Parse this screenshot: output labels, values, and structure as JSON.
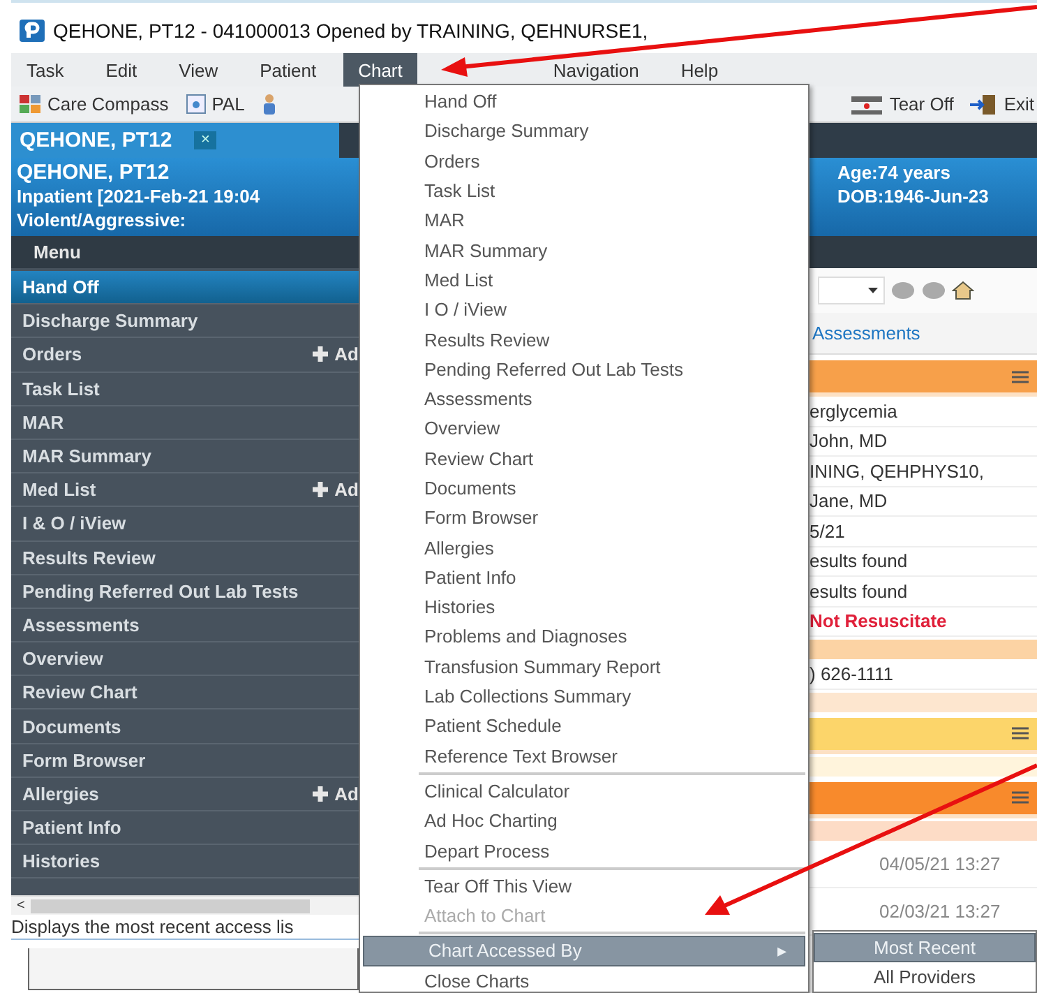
{
  "window": {
    "title": "QEHONE, PT12 - 041000013 Opened by TRAINING, QEHNURSE1,"
  },
  "menu_bar": [
    {
      "label": "Task",
      "selected": false
    },
    {
      "label": "Edit",
      "selected": false
    },
    {
      "label": "View",
      "selected": false
    },
    {
      "label": "Patient",
      "selected": false
    },
    {
      "label": "Chart",
      "selected": true
    },
    {
      "label": "Navigation",
      "selected": false
    },
    {
      "label": "Help",
      "selected": false
    }
  ],
  "toolbar": {
    "left": [
      {
        "kind": "compass",
        "label": "Care Compass"
      },
      {
        "kind": "pal",
        "label": "PAL"
      },
      {
        "kind": "person"
      }
    ],
    "right": [
      {
        "kind": "tearoff",
        "label": "Tear Off"
      },
      {
        "kind": "exit",
        "label": "Exit"
      }
    ]
  },
  "patient_tab": {
    "label": "QEHONE, PT12",
    "close": "×"
  },
  "banner": {
    "name": "QEHONE, PT12",
    "encounter": "Inpatient [2021-Feb-21 19:04",
    "alert": "Violent/Aggressive:",
    "age": "Age:74 years",
    "dob": "DOB:1946-Jun-23"
  },
  "sidebar": {
    "header": "Menu",
    "items": [
      {
        "label": "Hand Off",
        "selected": true
      },
      {
        "label": "Discharge Summary",
        "selected": false
      },
      {
        "label": "Orders",
        "selected": false,
        "action": "Ad"
      },
      {
        "label": "Task List",
        "selected": false
      },
      {
        "label": "MAR",
        "selected": false
      },
      {
        "label": "MAR Summary",
        "selected": false
      },
      {
        "label": "Med List",
        "selected": false,
        "action": "Ad"
      },
      {
        "label": "I & O / iView",
        "selected": false
      },
      {
        "label": "Results Review",
        "selected": false
      },
      {
        "label": "Pending Referred Out Lab Tests",
        "selected": false
      },
      {
        "label": "Assessments",
        "selected": false
      },
      {
        "label": "Overview",
        "selected": false
      },
      {
        "label": "Review Chart",
        "selected": false
      },
      {
        "label": "Documents",
        "selected": false
      },
      {
        "label": "Form Browser",
        "selected": false
      },
      {
        "label": "Allergies",
        "selected": false,
        "action": "Ad"
      },
      {
        "label": "Patient Info",
        "selected": false
      },
      {
        "label": "Histories",
        "selected": false
      }
    ]
  },
  "scroll_arrow": "<",
  "status_bar": "Displays the most recent access lis",
  "chart_menu": [
    {
      "kind": "item",
      "label": "Hand Off",
      "disabled": false,
      "selected": false
    },
    {
      "kind": "item",
      "label": "Discharge Summary",
      "disabled": false,
      "selected": false
    },
    {
      "kind": "item",
      "label": "Orders",
      "disabled": false,
      "selected": false
    },
    {
      "kind": "item",
      "label": "Task List",
      "disabled": false,
      "selected": false
    },
    {
      "kind": "item",
      "label": "MAR",
      "disabled": false,
      "selected": false
    },
    {
      "kind": "item",
      "label": "MAR Summary",
      "disabled": false,
      "selected": false
    },
    {
      "kind": "item",
      "label": "Med List",
      "disabled": false,
      "selected": false
    },
    {
      "kind": "item",
      "label": "I  O / iView",
      "disabled": false,
      "selected": false
    },
    {
      "kind": "item",
      "label": "Results Review",
      "disabled": false,
      "selected": false
    },
    {
      "kind": "item",
      "label": "Pending Referred Out Lab Tests",
      "disabled": false,
      "selected": false
    },
    {
      "kind": "item",
      "label": "Assessments",
      "disabled": false,
      "selected": false
    },
    {
      "kind": "item",
      "label": "Overview",
      "disabled": false,
      "selected": false
    },
    {
      "kind": "item",
      "label": "Review Chart",
      "disabled": false,
      "selected": false
    },
    {
      "kind": "item",
      "label": "Documents",
      "disabled": false,
      "selected": false
    },
    {
      "kind": "item",
      "label": "Form Browser",
      "disabled": false,
      "selected": false
    },
    {
      "kind": "item",
      "label": "Allergies",
      "disabled": false,
      "selected": false
    },
    {
      "kind": "item",
      "label": "Patient Info",
      "disabled": false,
      "selected": false
    },
    {
      "kind": "item",
      "label": "Histories",
      "disabled": false,
      "selected": false
    },
    {
      "kind": "item",
      "label": "Problems and Diagnoses",
      "disabled": false,
      "selected": false
    },
    {
      "kind": "item",
      "label": "Transfusion Summary Report",
      "disabled": false,
      "selected": false
    },
    {
      "kind": "item",
      "label": "Lab Collections Summary",
      "disabled": false,
      "selected": false
    },
    {
      "kind": "item",
      "label": "Patient Schedule",
      "disabled": false,
      "selected": false
    },
    {
      "kind": "item",
      "label": "Reference Text Browser",
      "disabled": false,
      "selected": false
    },
    {
      "kind": "separator"
    },
    {
      "kind": "item",
      "label": "Clinical Calculator",
      "disabled": false,
      "selected": false
    },
    {
      "kind": "item",
      "label": "Ad Hoc Charting",
      "disabled": false,
      "selected": false
    },
    {
      "kind": "item",
      "label": "Depart Process",
      "disabled": false,
      "selected": false
    },
    {
      "kind": "separator"
    },
    {
      "kind": "item",
      "label": "Tear Off This View",
      "disabled": false,
      "selected": false
    },
    {
      "kind": "item",
      "label": "Attach to Chart",
      "disabled": true,
      "selected": false
    },
    {
      "kind": "separator"
    },
    {
      "kind": "submenu",
      "label": "Chart Accessed By",
      "disabled": false,
      "selected": true,
      "arrow": "▸"
    },
    {
      "kind": "item",
      "label": "Close Charts",
      "disabled": false,
      "selected": false
    }
  ],
  "submenu": [
    {
      "label": "Most Recent",
      "selected": true
    },
    {
      "label": "All Providers",
      "selected": false
    }
  ],
  "content": [
    {
      "kind": "toolbar"
    },
    {
      "kind": "link",
      "text": "Assessments"
    },
    {
      "kind": "header",
      "color": "#f7a04a"
    },
    {
      "kind": "row",
      "text": "erglycemia"
    },
    {
      "kind": "row",
      "text": " John, MD"
    },
    {
      "kind": "row",
      "text": "INING, QEHPHYS10,"
    },
    {
      "kind": "row",
      "text": " Jane, MD"
    },
    {
      "kind": "row",
      "text": "5/21"
    },
    {
      "kind": "row",
      "text": "esults found"
    },
    {
      "kind": "row",
      "text": "esults found"
    },
    {
      "kind": "alert",
      "text": "Not Resuscitate"
    },
    {
      "kind": "band",
      "color": "#fcd3a4"
    },
    {
      "kind": "row",
      "text": ") 626-1111"
    },
    {
      "kind": "band",
      "color": "#fde6cf"
    },
    {
      "kind": "header",
      "color": "#fcd56a"
    },
    {
      "kind": "band",
      "color": "#fff4dc"
    },
    {
      "kind": "header",
      "color": "#f88a2c"
    },
    {
      "kind": "band",
      "color": "#fddcc6"
    },
    {
      "kind": "time",
      "text": "04/05/21 13:27"
    },
    {
      "kind": "time",
      "text": "02/03/21 13:27"
    }
  ]
}
